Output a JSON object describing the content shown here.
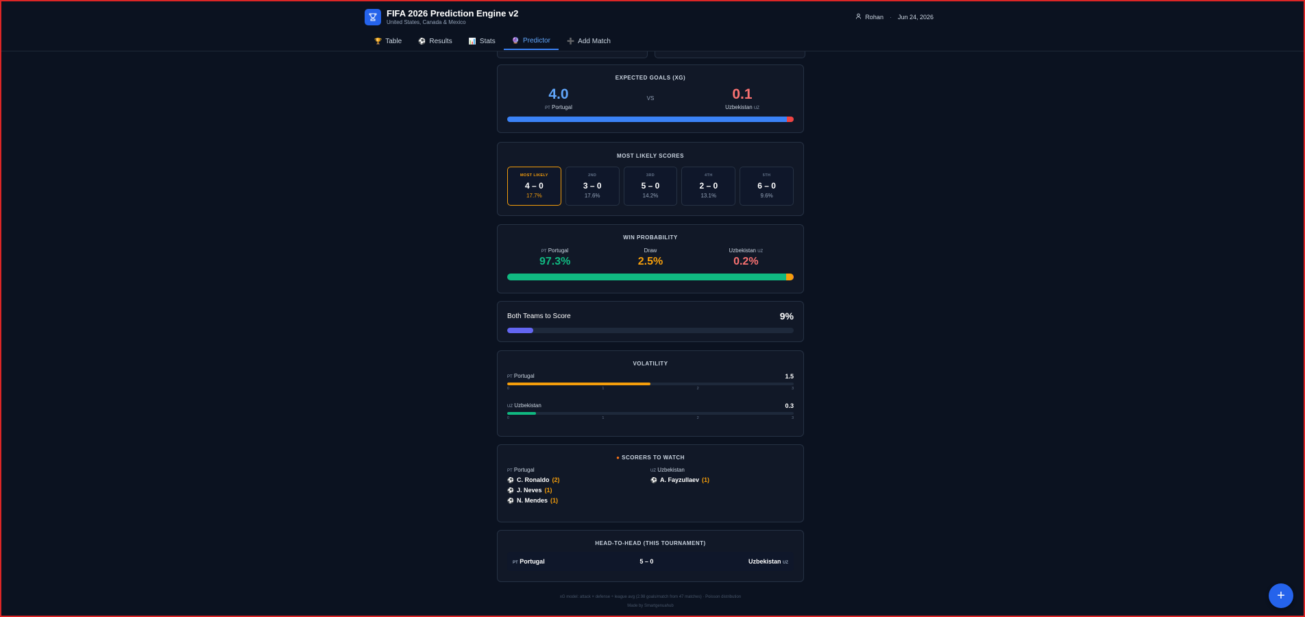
{
  "app": {
    "title": "FIFA 2026 Prediction Engine v2",
    "subtitle": "United States, Canada & Mexico",
    "user": "Rohan",
    "separator": "·",
    "date": "Jun 24, 2026"
  },
  "tabs": [
    {
      "icon": "🏆",
      "label": "Table"
    },
    {
      "icon": "⚽",
      "label": "Results"
    },
    {
      "icon": "📊",
      "label": "Stats"
    },
    {
      "icon": "🔮",
      "label": "Predictor"
    },
    {
      "icon": "➕",
      "label": "Add Match"
    }
  ],
  "active_tab": "Predictor",
  "teams": {
    "home": {
      "name": "Portugal",
      "code": "PT"
    },
    "away": {
      "name": "Uzbekistan",
      "code": "UZ"
    }
  },
  "xg": {
    "title": "EXPECTED GOALS (XG)",
    "home": "4.0",
    "away": "0.1",
    "vs": "VS",
    "home_share": 0.976,
    "colors": {
      "home": "#60a5fa",
      "away": "#f87171"
    }
  },
  "scores": {
    "title": "MOST LIKELY SCORES",
    "items": [
      {
        "rank": "MOST LIKELY",
        "score": "4 – 0",
        "pct": "17.7%"
      },
      {
        "rank": "2ND",
        "score": "3 – 0",
        "pct": "17.6%"
      },
      {
        "rank": "3RD",
        "score": "5 – 0",
        "pct": "14.2%"
      },
      {
        "rank": "4TH",
        "score": "2 – 0",
        "pct": "13.1%"
      },
      {
        "rank": "5TH",
        "score": "6 – 0",
        "pct": "9.6%"
      }
    ]
  },
  "win_prob": {
    "title": "WIN PROBABILITY",
    "draw_label": "Draw",
    "home": "97.3%",
    "draw": "2.5%",
    "away": "0.2%",
    "home_frac": 0.973,
    "draw_frac": 0.025,
    "away_frac": 0.002,
    "colors": {
      "home": "#10b981",
      "draw": "#f59e0b",
      "away": "#f87171"
    }
  },
  "btts": {
    "label": "Both Teams to Score",
    "value": "9%",
    "frac": 0.09
  },
  "volatility": {
    "title": "VOLATILITY",
    "home": "1.5",
    "away": "0.3",
    "home_val": 1.5,
    "away_val": 0.3,
    "max": 3,
    "ticks": [
      "0",
      "1",
      "2",
      "3"
    ]
  },
  "scorers": {
    "title": "SCORERS TO WATCH",
    "home": [
      {
        "name": "C. Ronaldo",
        "goals": "(2)"
      },
      {
        "name": "J. Neves",
        "goals": "(1)"
      },
      {
        "name": "N. Mendes",
        "goals": "(1)"
      }
    ],
    "away": [
      {
        "name": "A. Fayzullaev",
        "goals": "(1)"
      }
    ]
  },
  "h2h": {
    "title": "HEAD-TO-HEAD (THIS TOURNAMENT)",
    "score": "5 – 0"
  },
  "footer": {
    "line1": "xG model: attack × defense ÷ league avg (2.98 goals/match from 47 matches) · Poisson distribution",
    "line2": "Made by Smartgenuahub"
  },
  "fab": "+"
}
